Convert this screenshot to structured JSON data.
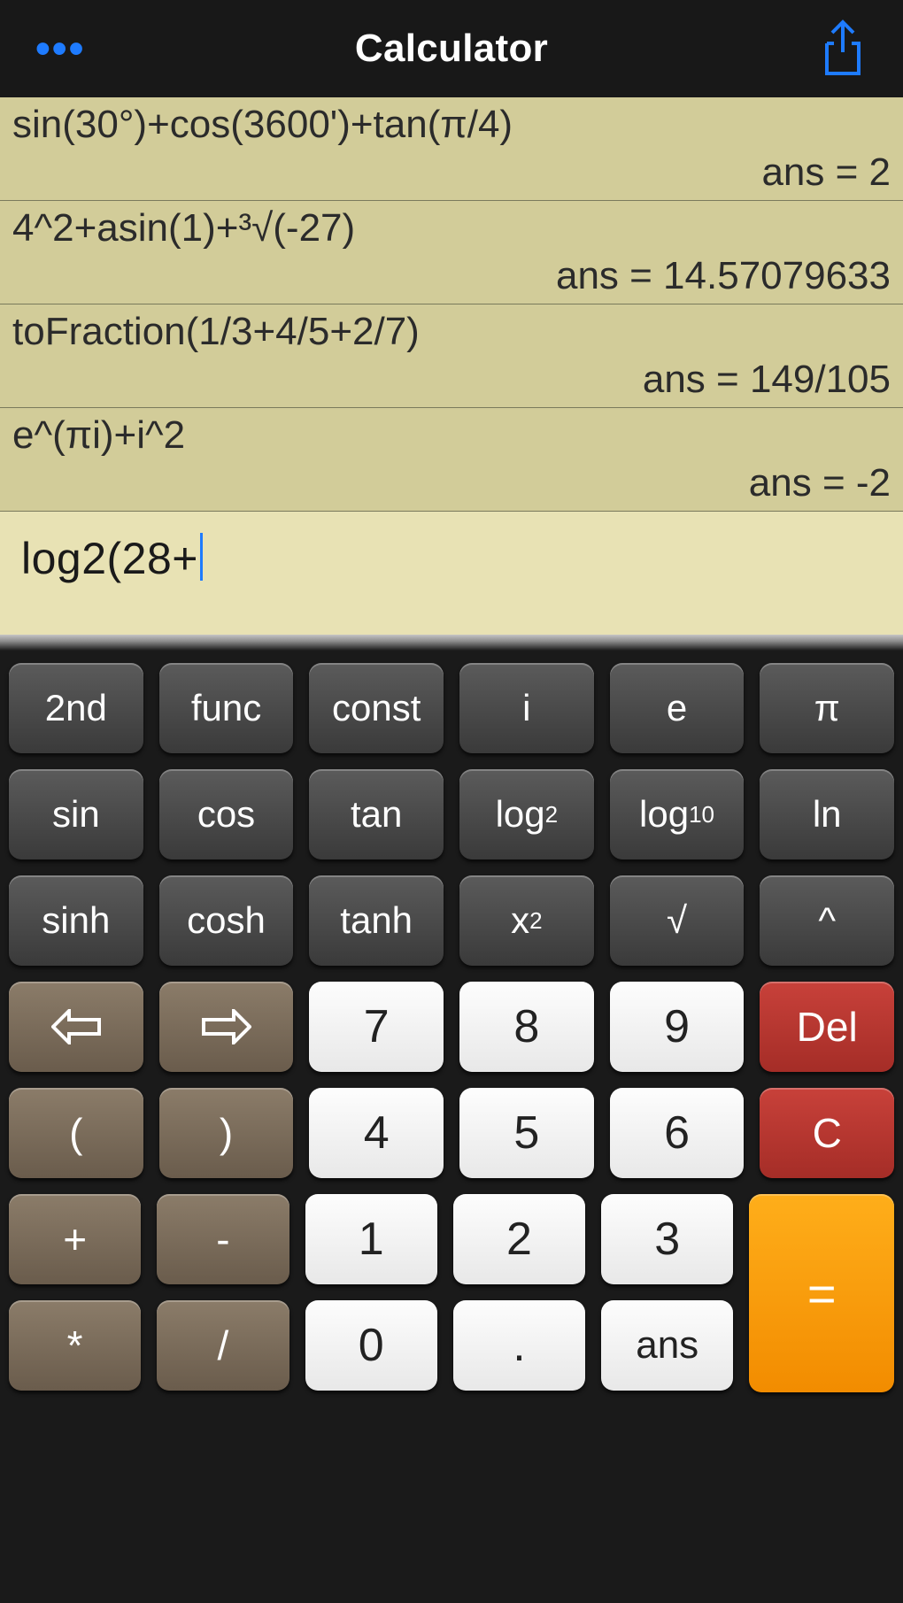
{
  "header": {
    "title": "Calculator"
  },
  "history": [
    {
      "expr": "sin(30°)+cos(3600')+tan(π/4)",
      "ans": "ans = 2"
    },
    {
      "expr": "4^2+asin(1)+³√(-27)",
      "ans": "ans = 14.57079633"
    },
    {
      "expr": "toFraction(1/3+4/5+2/7)",
      "ans": "ans = 149/105"
    },
    {
      "expr": "e^(πi)+i^2",
      "ans": "ans = -2"
    }
  ],
  "input": "log2(28+",
  "keys": {
    "r1": [
      "2nd",
      "func",
      "const",
      "i",
      "e",
      "π"
    ],
    "r2": [
      "sin",
      "cos",
      "tan",
      "log₂",
      "log₁₀",
      "ln"
    ],
    "r3": [
      "sinh",
      "cosh",
      "tanh",
      "x²",
      "√",
      "^"
    ],
    "r4": [
      "⇦",
      "⇨",
      "7",
      "8",
      "9",
      "Del"
    ],
    "r5": [
      "(",
      ")",
      "4",
      "5",
      "6",
      "C"
    ],
    "r6": [
      "+",
      "-",
      "1",
      "2",
      "3"
    ],
    "r7": [
      "*",
      "/",
      "0",
      ".",
      "ans"
    ],
    "eq": "="
  }
}
